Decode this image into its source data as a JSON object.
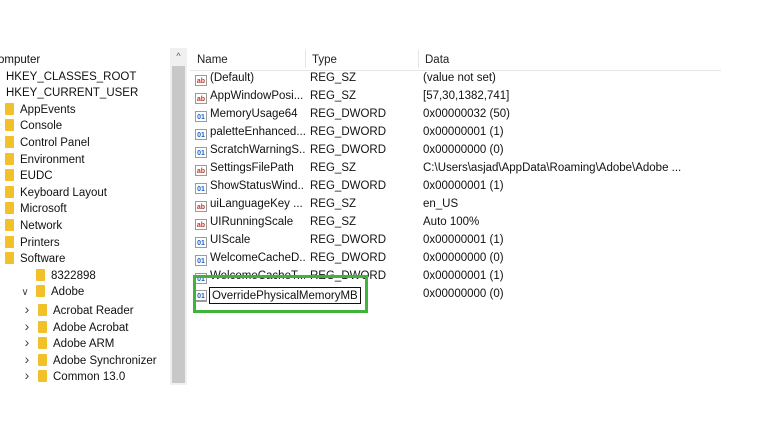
{
  "tree": {
    "items": [
      {
        "label": "omputer",
        "indent": 0,
        "folder": false,
        "chevron": ""
      },
      {
        "label": "HKEY_CLASSES_ROOT",
        "indent": 1,
        "folder": false,
        "chevron": ""
      },
      {
        "label": "HKEY_CURRENT_USER",
        "indent": 1,
        "folder": false,
        "chevron": ""
      },
      {
        "label": "AppEvents",
        "indent": 2,
        "folder": true,
        "chevron": ""
      },
      {
        "label": "Console",
        "indent": 2,
        "folder": true,
        "chevron": ""
      },
      {
        "label": "Control Panel",
        "indent": 2,
        "folder": true,
        "chevron": ""
      },
      {
        "label": "Environment",
        "indent": 2,
        "folder": true,
        "chevron": ""
      },
      {
        "label": "EUDC",
        "indent": 2,
        "folder": true,
        "chevron": ""
      },
      {
        "label": "Keyboard Layout",
        "indent": 2,
        "folder": true,
        "chevron": ""
      },
      {
        "label": "Microsoft",
        "indent": 2,
        "folder": true,
        "chevron": ""
      },
      {
        "label": "Network",
        "indent": 2,
        "folder": true,
        "chevron": ""
      },
      {
        "label": "Printers",
        "indent": 2,
        "folder": true,
        "chevron": ""
      },
      {
        "label": "Software",
        "indent": 2,
        "folder": true,
        "chevron": ""
      },
      {
        "label": "8322898",
        "indent": 3,
        "folder": true,
        "chevron": ""
      },
      {
        "label": "Adobe",
        "indent": 3,
        "folder": true,
        "chevron": "open"
      },
      {
        "label": "Acrobat Reader",
        "indent": 4,
        "folder": true,
        "chevron": "closed"
      },
      {
        "label": "Adobe Acrobat",
        "indent": 4,
        "folder": true,
        "chevron": "closed"
      },
      {
        "label": "Adobe ARM",
        "indent": 4,
        "folder": true,
        "chevron": "closed"
      },
      {
        "label": "Adobe Synchronizer",
        "indent": 4,
        "folder": true,
        "chevron": "closed"
      },
      {
        "label": "Common 13.0",
        "indent": 4,
        "folder": true,
        "chevron": "closed"
      }
    ],
    "scroll_up_glyph": "^"
  },
  "list": {
    "headers": {
      "name": "Name",
      "type": "Type",
      "data": "Data"
    },
    "rows": [
      {
        "icon": "ab",
        "name": "(Default)",
        "type": "REG_SZ",
        "data": "(value not set)"
      },
      {
        "icon": "ab",
        "name": "AppWindowPosi...",
        "type": "REG_SZ",
        "data": "[57,30,1382,741]"
      },
      {
        "icon": "bin",
        "name": "MemoryUsage64",
        "type": "REG_DWORD",
        "data": "0x00000032 (50)"
      },
      {
        "icon": "bin",
        "name": "paletteEnhanced...",
        "type": "REG_DWORD",
        "data": "0x00000001 (1)"
      },
      {
        "icon": "bin",
        "name": "ScratchWarningS...",
        "type": "REG_DWORD",
        "data": "0x00000000 (0)"
      },
      {
        "icon": "ab",
        "name": "SettingsFilePath",
        "type": "REG_SZ",
        "data": "C:\\Users\\asjad\\AppData\\Roaming\\Adobe\\Adobe ..."
      },
      {
        "icon": "bin",
        "name": "ShowStatusWind...",
        "type": "REG_DWORD",
        "data": "0x00000001 (1)"
      },
      {
        "icon": "ab",
        "name": "uiLanguageKey ...",
        "type": "REG_SZ",
        "data": "en_US"
      },
      {
        "icon": "ab",
        "name": "UIRunningScale",
        "type": "REG_SZ",
        "data": "Auto 100%"
      },
      {
        "icon": "bin",
        "name": "UIScale",
        "type": "REG_DWORD",
        "data": "0x00000001 (1)"
      },
      {
        "icon": "bin",
        "name": "WelcomeCacheD...",
        "type": "REG_DWORD",
        "data": "0x00000000 (0)"
      },
      {
        "icon": "bin",
        "name": "WelcomeCacheT...",
        "type": "REG_DWORD",
        "data": "0x00000001 (1)"
      },
      {
        "icon": "bin",
        "name": "",
        "type": "",
        "data": "0x00000000 (0)"
      }
    ],
    "rename_value": "OverridePhysicalMemoryMB",
    "icon_labels": {
      "ab": "ab",
      "bin": "01"
    }
  },
  "colors": {
    "highlight": "#3fb33b",
    "folder": "#f2c029"
  }
}
